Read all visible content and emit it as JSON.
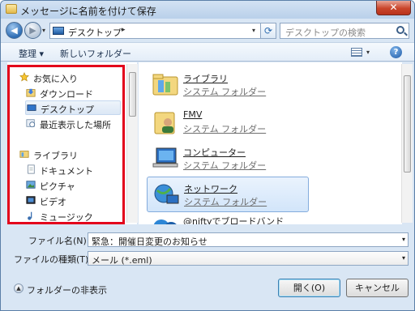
{
  "window": {
    "title": "メッセージに名前を付けて保存",
    "close_label": "✕"
  },
  "address": {
    "location": "デスクトップ",
    "separator": "▸",
    "refresh_icon": "refresh-icon"
  },
  "search": {
    "placeholder": "デスクトップの検索"
  },
  "toolbar": {
    "organize_label": "整理 ▾",
    "new_folder_label": "新しいフォルダー",
    "help_label": "?"
  },
  "nav": {
    "favorites": {
      "label": "お気に入り",
      "items": [
        {
          "label": "ダウンロード",
          "icon": "downloads-folder-icon"
        },
        {
          "label": "デスクトップ",
          "icon": "desktop-icon"
        },
        {
          "label": "最近表示した場所",
          "icon": "recent-places-icon"
        }
      ]
    },
    "libraries": {
      "label": "ライブラリ",
      "items": [
        {
          "label": "ドキュメント",
          "icon": "documents-icon"
        },
        {
          "label": "ピクチャ",
          "icon": "pictures-icon"
        },
        {
          "label": "ビデオ",
          "icon": "videos-icon"
        },
        {
          "label": "ミュージック",
          "icon": "music-icon"
        }
      ]
    }
  },
  "files": [
    {
      "name": "ライブラリ",
      "desc": "システム フォルダー",
      "icon": "library-folder-icon"
    },
    {
      "name": "FMV",
      "desc": "システム フォルダー",
      "icon": "user-folder-icon"
    },
    {
      "name": "コンピューター",
      "desc": "システム フォルダー",
      "icon": "computer-icon"
    },
    {
      "name": "ネットワーク",
      "desc": "システム フォルダー",
      "icon": "network-icon"
    },
    {
      "name": "@niftyでブロードバンド",
      "desc": "",
      "icon": "nifty-shortcut-icon"
    }
  ],
  "form": {
    "filename_label": "ファイル名(N):",
    "filename_value": "緊急：開催日変更のお知らせ",
    "filetype_label": "ファイルの種類(T):",
    "filetype_value": "メール (*.eml)"
  },
  "footer": {
    "hide_folders_label": "フォルダーの非表示",
    "open_label": "開く(O)",
    "cancel_label": "キャンセル"
  },
  "colors": {
    "highlight_box": "#e3001b",
    "selection": "#d2e5fa"
  }
}
